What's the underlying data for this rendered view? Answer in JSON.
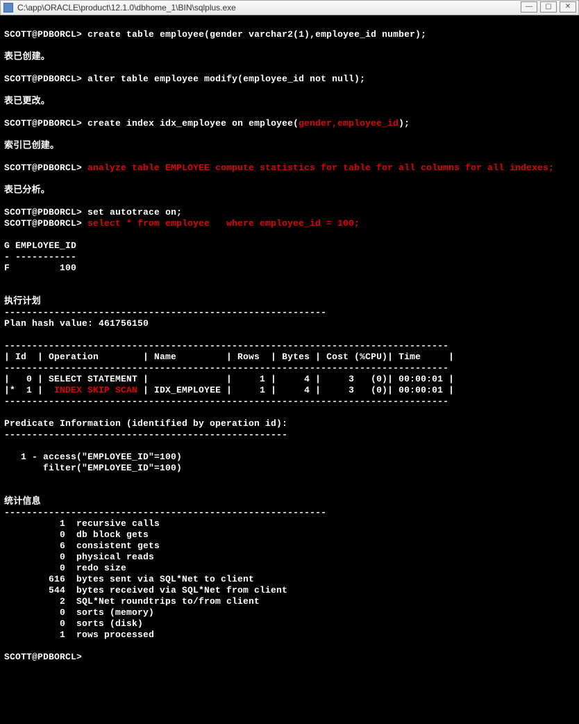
{
  "window": {
    "title": "C:\\app\\ORACLE\\product\\12.1.0\\dbhome_1\\BIN\\sqlplus.exe"
  },
  "prompt": "SCOTT@PDBORCL>",
  "session": {
    "cmd1": "create table employee(gender varchar2(1),employee_id number);",
    "msg1": "表已创建。",
    "cmd2": "alter table employee modify(employee_id not null);",
    "msg2": "表已更改。",
    "cmd3a": "create index idx_employee on employee(",
    "cmd3_red": "gender,employee_id",
    "cmd3b": ");",
    "msg3": "索引已创建。",
    "cmd4_red": "analyze table EMPLOYEE compute statistics for table for all columns for all indexes;",
    "msg4": "表已分析。",
    "cmd5": "set autotrace on;",
    "cmd6_red": "select * from employee   where employee_id = 100;",
    "result_header": "G EMPLOYEE_ID",
    "result_sep": "- -----------",
    "result_row": "F         100",
    "plan_title": "执行计划",
    "plan_hash": "Plan hash value: 461756150",
    "plan_hr": "--------------------------------------------------------------------------------",
    "plan_hdr": "| Id  | Operation        | Name         | Rows  | Bytes | Cost (%CPU)| Time     |",
    "plan_row0": "|   0 | SELECT STATEMENT |              |     1 |     4 |     3   (0)| 00:00:01 |",
    "plan_row1a": "|*  1 |  ",
    "plan_row1_red": "INDEX SKIP SCAN",
    "plan_row1b": " | IDX_EMPLOYEE |     1 |     4 |     3   (0)| 00:00:01 |",
    "pred_title": "Predicate Information (identified by operation id):",
    "pred_hr": "---------------------------------------------------",
    "pred1": "   1 - access(\"EMPLOYEE_ID\"=100)",
    "pred2": "       filter(\"EMPLOYEE_ID\"=100)",
    "stats_title": "统计信息",
    "stats_hr": "----------------------------------------------------------",
    "stats": [
      "          1  recursive calls",
      "          0  db block gets",
      "          6  consistent gets",
      "          0  physical reads",
      "          0  redo size",
      "        616  bytes sent via SQL*Net to client",
      "        544  bytes received via SQL*Net from client",
      "          2  SQL*Net roundtrips to/from client",
      "          0  sorts (memory)",
      "          0  sorts (disk)",
      "          1  rows processed"
    ]
  }
}
